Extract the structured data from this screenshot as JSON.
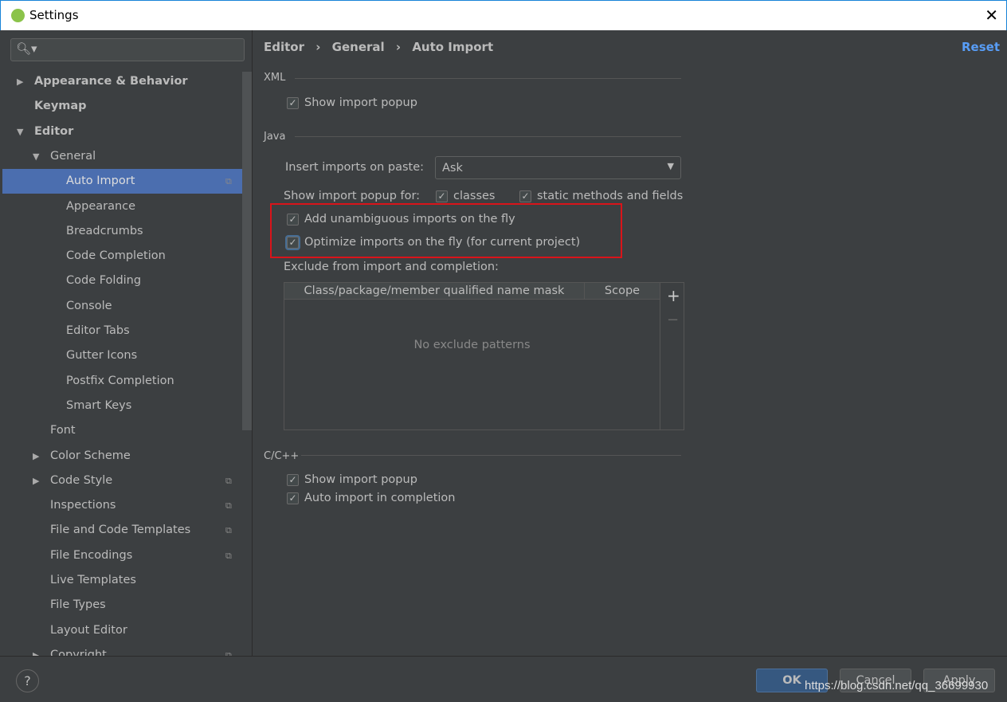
{
  "window": {
    "title": "Settings",
    "close": "✕"
  },
  "search": {
    "icon": "🔍︎▾",
    "placeholder": ""
  },
  "sidebar": {
    "items": [
      {
        "label": "Appearance & Behavior",
        "level": 0,
        "bold": true,
        "arrow": "▶"
      },
      {
        "label": "Keymap",
        "level": 0,
        "bold": true
      },
      {
        "label": "Editor",
        "level": 0,
        "bold": true,
        "arrow": "▼"
      },
      {
        "label": "General",
        "level": 1,
        "arrow": "▼"
      },
      {
        "label": "Auto Import",
        "level": 2,
        "selected": true,
        "copy": true
      },
      {
        "label": "Appearance",
        "level": 2
      },
      {
        "label": "Breadcrumbs",
        "level": 2
      },
      {
        "label": "Code Completion",
        "level": 2
      },
      {
        "label": "Code Folding",
        "level": 2
      },
      {
        "label": "Console",
        "level": 2
      },
      {
        "label": "Editor Tabs",
        "level": 2
      },
      {
        "label": "Gutter Icons",
        "level": 2
      },
      {
        "label": "Postfix Completion",
        "level": 2
      },
      {
        "label": "Smart Keys",
        "level": 2
      },
      {
        "label": "Font",
        "level": 1
      },
      {
        "label": "Color Scheme",
        "level": 1,
        "arrow": "▶"
      },
      {
        "label": "Code Style",
        "level": 1,
        "arrow": "▶",
        "copy": true
      },
      {
        "label": "Inspections",
        "level": 1,
        "copy": true
      },
      {
        "label": "File and Code Templates",
        "level": 1,
        "copy": true
      },
      {
        "label": "File Encodings",
        "level": 1,
        "copy": true
      },
      {
        "label": "Live Templates",
        "level": 1
      },
      {
        "label": "File Types",
        "level": 1
      },
      {
        "label": "Layout Editor",
        "level": 1
      },
      {
        "label": "Copyright",
        "level": 1,
        "arrow": "▶",
        "copy": true
      }
    ]
  },
  "breadcrumb": [
    "Editor",
    "General",
    "Auto Import"
  ],
  "breadcrumb_sep": "›",
  "reset": "Reset",
  "xml": {
    "title": "XML",
    "show_popup": "Show import popup",
    "show_popup_checked": true
  },
  "java": {
    "title": "Java",
    "insert_label": "Insert imports on paste:",
    "insert_value": "Ask",
    "popup_for": "Show import popup for:",
    "classes": "classes",
    "static": "static methods and fields",
    "add_unambiguous": "Add unambiguous imports on the fly",
    "optimize": "Optimize imports on the fly (for current project)",
    "exclude_label": "Exclude from import and completion:",
    "columns": [
      "Class/package/member qualified name mask",
      "Scope"
    ],
    "empty": "No exclude patterns",
    "add": "+",
    "remove": "−"
  },
  "cpp": {
    "title": "C/C++",
    "show_popup": "Show import popup",
    "auto_import": "Auto import in completion"
  },
  "check": "✓",
  "footer": {
    "help": "?",
    "ok": "OK",
    "cancel": "Cancel",
    "apply": "Apply",
    "watermark": "https://blog.csdn.net/qq_36699930"
  },
  "colors": {
    "selection": "#4b6eaf",
    "accent": "#589df6",
    "highlight_box": "#d9141a"
  }
}
